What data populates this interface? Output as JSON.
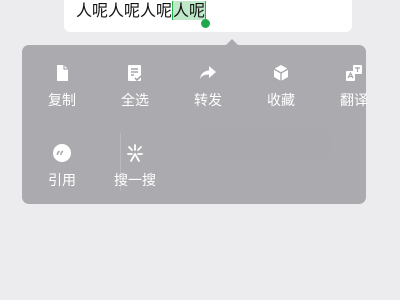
{
  "message": {
    "text_before": "人呢人呢人呢",
    "text_selected": "人呢"
  },
  "menu": {
    "items": [
      {
        "label": "复制",
        "icon": "copy-icon"
      },
      {
        "label": "全选",
        "icon": "select-all-icon"
      },
      {
        "label": "转发",
        "icon": "forward-icon"
      },
      {
        "label": "收藏",
        "icon": "favorite-icon"
      },
      {
        "label": "翻译",
        "icon": "translate-icon"
      },
      {
        "label": "引用",
        "icon": "quote-icon"
      },
      {
        "label": "搜一搜",
        "icon": "search-icon"
      }
    ]
  },
  "colors": {
    "background": "#ecebee",
    "menu": "#a6a6aa",
    "selection": "#bfe8c8",
    "selection_handle": "#1ea84a"
  }
}
